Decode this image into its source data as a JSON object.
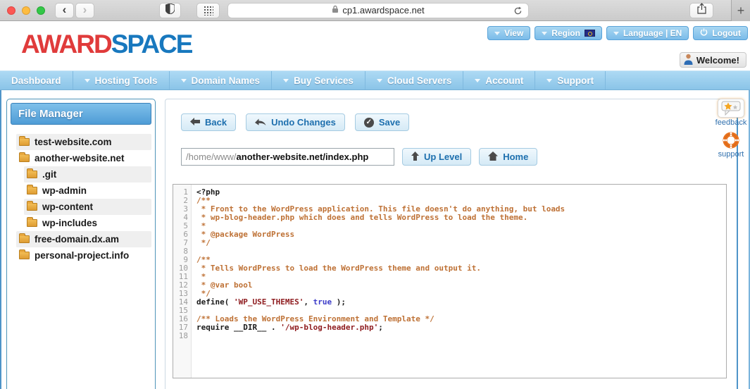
{
  "colors": {
    "brand_red": "#E03B3B",
    "brand_blue": "#1878BE",
    "nav_blue": "#8FC7EA",
    "button_text_blue": "#1D6FAE",
    "code_comment": "#BE7135",
    "code_string": "#8F1D20",
    "code_keyword": "#3B3BC8",
    "folder_orange": "#E9A93F"
  },
  "browser": {
    "url": "cp1.awardspace.net",
    "back_glyph": "‹",
    "forward_glyph": "›",
    "new_tab_glyph": "+"
  },
  "header": {
    "logo_award": "AWARD",
    "logo_space": "SPACE",
    "welcome": "Welcome!",
    "actions": [
      {
        "label": "View",
        "icon": "chevron-down-icon"
      },
      {
        "label": "Region",
        "icon": "chevron-down-icon",
        "flag": "eu-flag-icon"
      },
      {
        "label": "Language | EN",
        "icon": "chevron-down-icon"
      },
      {
        "label": "Logout",
        "icon": "power-icon"
      }
    ]
  },
  "nav": {
    "items": [
      {
        "label": "Dashboard",
        "arrow": false
      },
      {
        "label": "Hosting Tools",
        "arrow": true
      },
      {
        "label": "Domain Names",
        "arrow": true
      },
      {
        "label": "Buy Services",
        "arrow": true
      },
      {
        "label": "Cloud Servers",
        "arrow": true
      },
      {
        "label": "Account",
        "arrow": true
      },
      {
        "label": "Support",
        "arrow": true
      }
    ]
  },
  "sidebar": {
    "title": "File Manager",
    "tree": [
      {
        "label": "test-website.com",
        "level": 0
      },
      {
        "label": "another-website.net",
        "level": 0
      },
      {
        "label": ".git",
        "level": 1
      },
      {
        "label": "wp-admin",
        "level": 1
      },
      {
        "label": "wp-content",
        "level": 1
      },
      {
        "label": "wp-includes",
        "level": 1
      },
      {
        "label": "free-domain.dx.am",
        "level": 0
      },
      {
        "label": "personal-project.info",
        "level": 0
      }
    ]
  },
  "toolbar": {
    "back_label": "Back",
    "undo_label": "Undo Changes",
    "save_label": "Save",
    "up_level_label": "Up Level",
    "home_label": "Home"
  },
  "path": {
    "prefix": "/home/www/",
    "rest": "another-website.net/index.php"
  },
  "editor": {
    "lines": [
      {
        "n": 1,
        "segs": [
          {
            "c": "plain",
            "t": "<?php"
          }
        ]
      },
      {
        "n": 2,
        "segs": [
          {
            "c": "cmt",
            "t": "/**"
          }
        ]
      },
      {
        "n": 3,
        "segs": [
          {
            "c": "cmt",
            "t": " * Front to the WordPress application. This file doesn't do anything, but loads"
          }
        ]
      },
      {
        "n": 4,
        "segs": [
          {
            "c": "cmt",
            "t": " * wp-blog-header.php which does and tells WordPress to load the theme."
          }
        ]
      },
      {
        "n": 5,
        "segs": [
          {
            "c": "cmt",
            "t": " *"
          }
        ]
      },
      {
        "n": 6,
        "segs": [
          {
            "c": "cmt",
            "t": " * @package WordPress"
          }
        ]
      },
      {
        "n": 7,
        "segs": [
          {
            "c": "cmt",
            "t": " */"
          }
        ]
      },
      {
        "n": 8,
        "segs": []
      },
      {
        "n": 9,
        "segs": [
          {
            "c": "cmt",
            "t": "/**"
          }
        ]
      },
      {
        "n": 10,
        "segs": [
          {
            "c": "cmt",
            "t": " * Tells WordPress to load the WordPress theme and output it."
          }
        ]
      },
      {
        "n": 11,
        "segs": [
          {
            "c": "cmt",
            "t": " *"
          }
        ]
      },
      {
        "n": 12,
        "segs": [
          {
            "c": "cmt",
            "t": " * @var bool"
          }
        ]
      },
      {
        "n": 13,
        "segs": [
          {
            "c": "cmt",
            "t": " */"
          }
        ]
      },
      {
        "n": 14,
        "segs": [
          {
            "c": "plain",
            "t": "define( "
          },
          {
            "c": "str",
            "t": "'WP_USE_THEMES'"
          },
          {
            "c": "plain",
            "t": ", "
          },
          {
            "c": "kw",
            "t": "true"
          },
          {
            "c": "plain",
            "t": " );"
          }
        ]
      },
      {
        "n": 15,
        "segs": []
      },
      {
        "n": 16,
        "segs": [
          {
            "c": "cmt",
            "t": "/** Loads the WordPress Environment and Template */"
          }
        ]
      },
      {
        "n": 17,
        "segs": [
          {
            "c": "plain",
            "t": "require __DIR__ . "
          },
          {
            "c": "str",
            "t": "'/wp-blog-header.php'"
          },
          {
            "c": "plain",
            "t": ";"
          }
        ]
      },
      {
        "n": 18,
        "segs": []
      }
    ]
  },
  "widgets": {
    "feedback_label": "feedback",
    "support_label": "support"
  }
}
